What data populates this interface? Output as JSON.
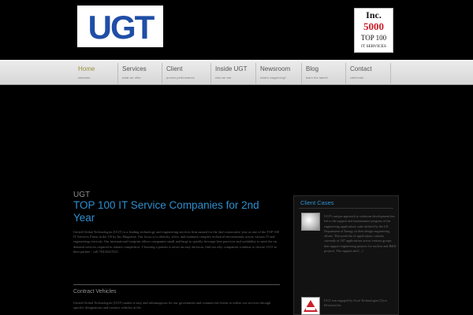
{
  "brand": {
    "logo_text": "UGT",
    "inc_logo_lines": [
      "Inc.",
      "5000",
      "TOP 100",
      "IT SERVICES"
    ],
    "colors": {
      "accent_blue": "#2e8fcf",
      "logo_blue": "#1f4ea6",
      "inc_red": "#c8202a",
      "active_nav": "#9a8f3d"
    }
  },
  "nav": {
    "items": [
      {
        "label": "Home",
        "sub": "welcome"
      },
      {
        "label": "Services",
        "sub": "what we offer"
      },
      {
        "label": "Client",
        "sub": "proven performance"
      },
      {
        "label": "Inside UGT",
        "sub": "who we are"
      },
      {
        "label": "Newsroom",
        "sub": "what's happening?"
      },
      {
        "label": "Blog",
        "sub": "learn the latest!"
      },
      {
        "label": "Contact",
        "sub": "call/email"
      }
    ]
  },
  "main": {
    "eyebrow": "UGT",
    "title": "TOP 100 IT Service Companies for 2nd Year",
    "body": "United Global Technologies (UGT) is a leading technology and engineering services firm named for the 2nd consecutive year as one of the TOP 100 IT Services Firms in the US by Inc.Magazine. Our focus is to identify, solve, and maintain complex technical environments across various IT and engineering verticals. Our international footprint allows companies small and large to quickly leverage best practices and scalability to meet the on demand services required to remain competitive. Choosing a partner is never an easy decision, find out why companies continue to choose UGT as their partner - call 704.844.5521.",
    "contract_title": "Contract Vehicles",
    "contract_body": "United Global Technologies (UGT) makes it easy and advantageous for our government and commercial clients to utilize our services through specific designations and contract vehicles at the"
  },
  "sidebar": {
    "title": "Client Cases",
    "cases": [
      {
        "text": "UGT's unique approach to solutions development has led to the support and maintenance program of the engineering applications suite utilized by the US Department of Energy in their design engineering efforts. This portfolio of applications consists currently of 187 applications across various groups that support engineering projects for nuclear and R&D projects. The support and [...]"
      },
      {
        "text": "UGT was engaged by Scott Technologies (Tyco Division) for"
      }
    ]
  }
}
